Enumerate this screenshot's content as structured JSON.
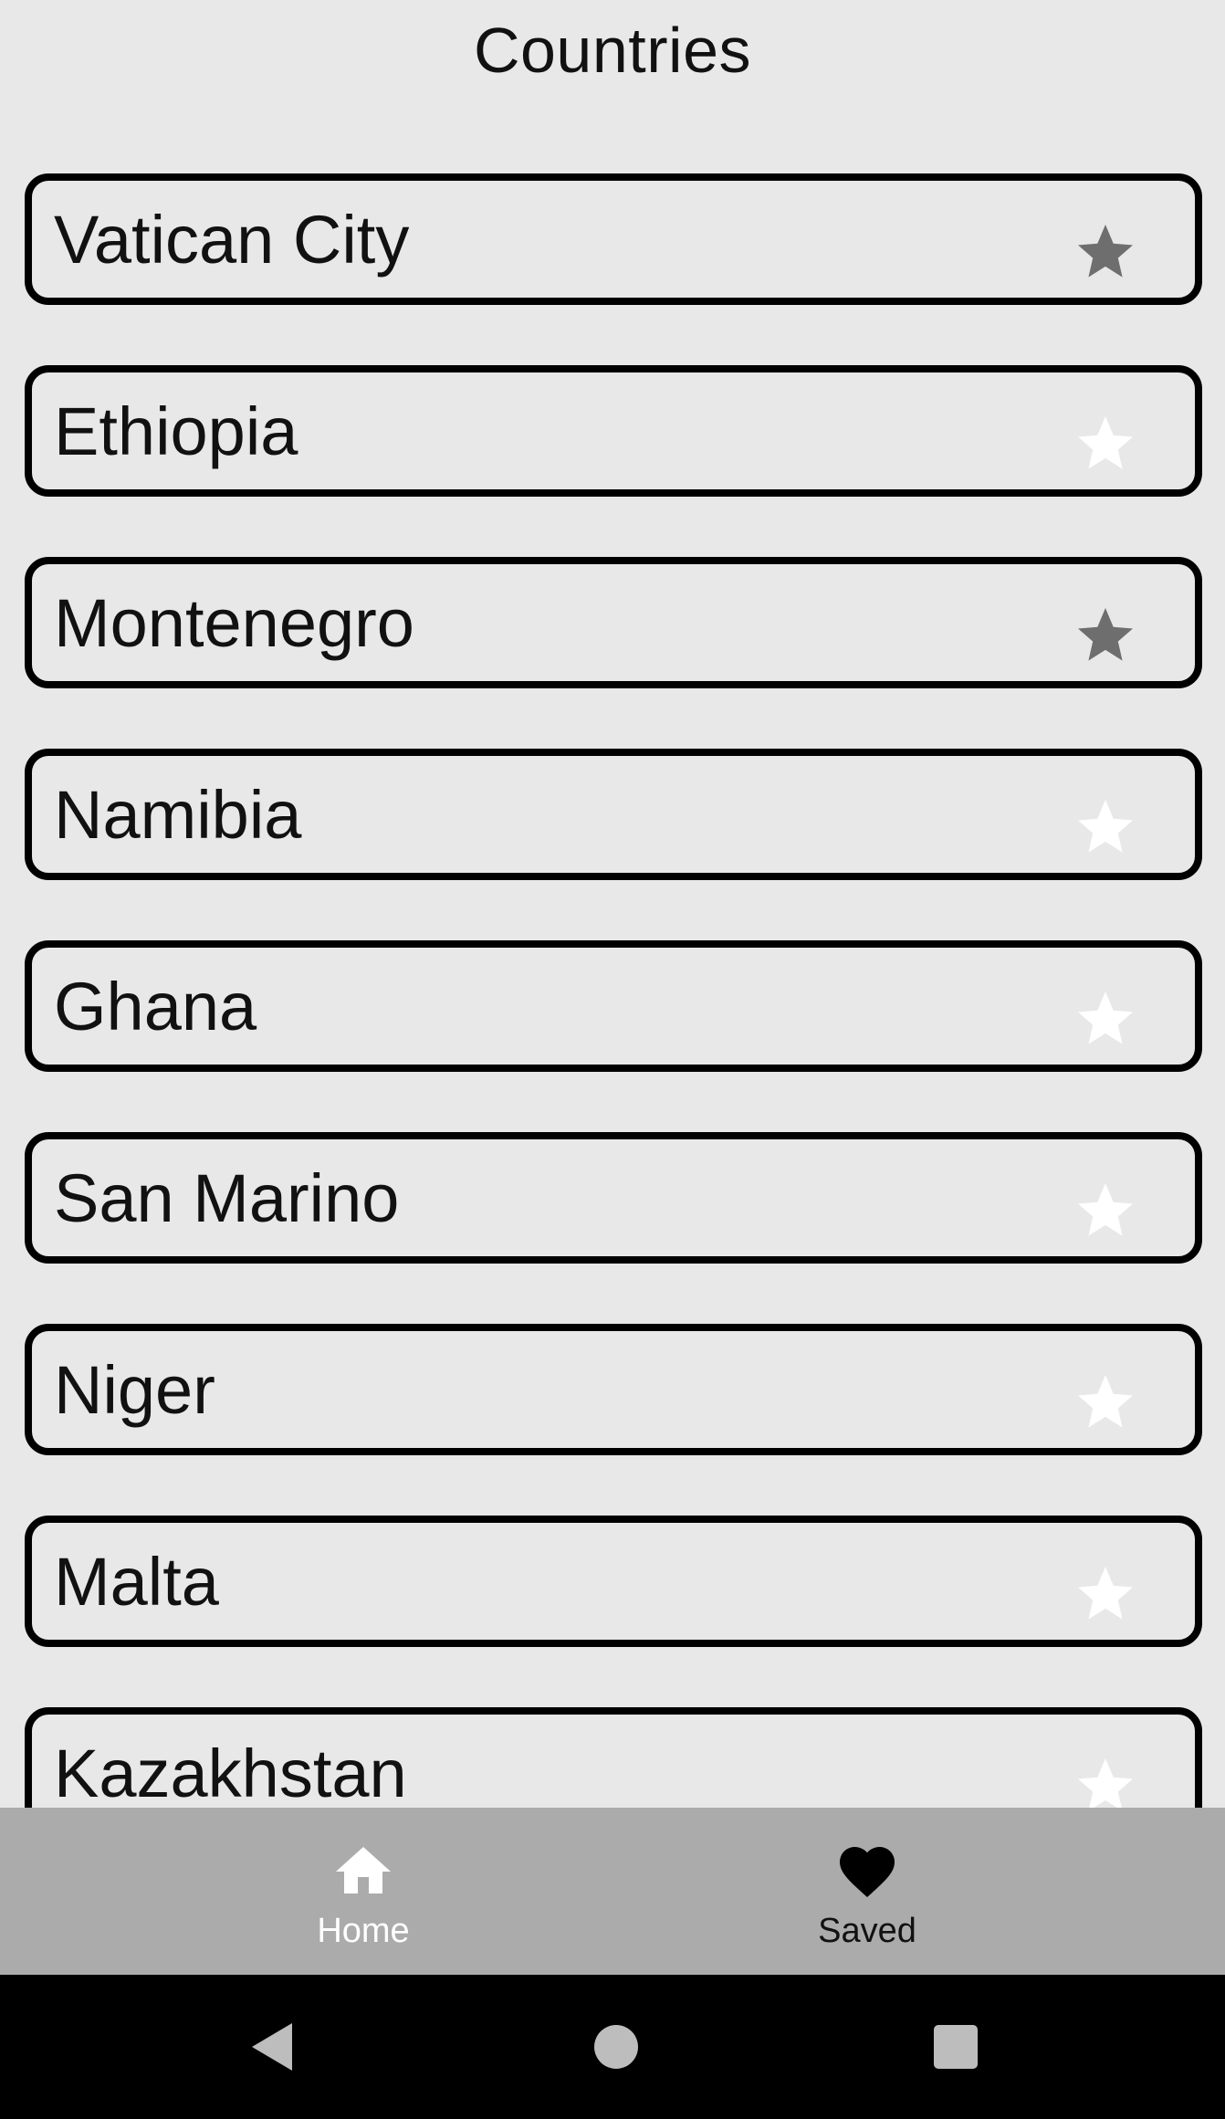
{
  "header": {
    "title": "Countries"
  },
  "countries": [
    {
      "name": "Vatican City",
      "favorite": true
    },
    {
      "name": "Ethiopia",
      "favorite": false
    },
    {
      "name": "Montenegro",
      "favorite": true
    },
    {
      "name": "Namibia",
      "favorite": false
    },
    {
      "name": "Ghana",
      "favorite": false
    },
    {
      "name": "San Marino",
      "favorite": false
    },
    {
      "name": "Niger",
      "favorite": false
    },
    {
      "name": "Malta",
      "favorite": false
    },
    {
      "name": "Kazakhstan",
      "favorite": false
    }
  ],
  "bottom_nav": {
    "items": [
      {
        "label": "Home",
        "icon": "home-icon",
        "active": true
      },
      {
        "label": "Saved",
        "icon": "heart-icon",
        "active": false
      }
    ]
  },
  "colors": {
    "background": "#e8e8e8",
    "star_favorite": "#6e6e6e",
    "star_default": "#ffffff",
    "nav_background": "#ababab",
    "system_bar": "#000000"
  },
  "system_nav": {
    "buttons": [
      "back-icon",
      "home-circle-icon",
      "recents-icon"
    ]
  }
}
